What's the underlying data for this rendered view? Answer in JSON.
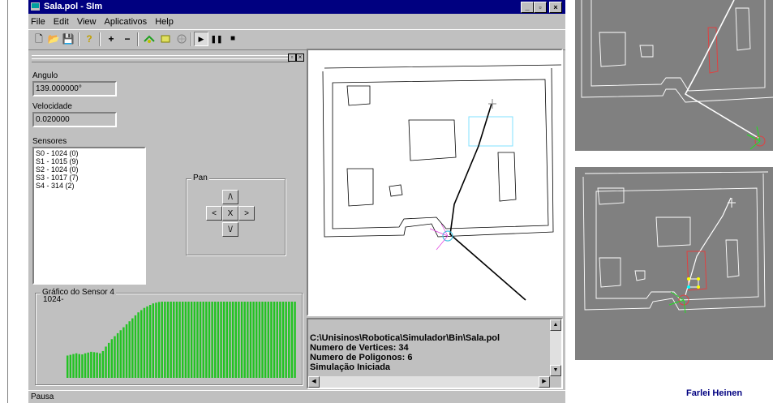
{
  "window": {
    "title": "Sala.pol - SIm",
    "minimize": "_",
    "maximize": "▫",
    "close": "×"
  },
  "menu": [
    "File",
    "Edit",
    "View",
    "Aplicativos",
    "Help"
  ],
  "toolbar": {
    "new": "🗋",
    "open": "📂",
    "save": "💾",
    "help": "?",
    "add": "+",
    "remove": "−",
    "play": "▶",
    "pause": "❚❚",
    "stop": "■"
  },
  "panel": {
    "angulo_label": "Angulo",
    "angulo_value": "139.000000°",
    "velocidade_label": "Velocidade",
    "velocidade_value": "0.020000",
    "sensores_label": "Sensores",
    "sensores": [
      "S0 - 1024 (0)",
      "S1 - 1015 (9)",
      "S2 - 1024 (0)",
      "S3 - 1017 (7)",
      "S4 - 314 (2)"
    ],
    "pan_label": "Pan",
    "pan": {
      "up": "/\\",
      "left": "<",
      "center": "X",
      "right": ">",
      "down": "\\/"
    },
    "grafico_label": "Gráfico do Sensor 4",
    "grafico_max": "1024-"
  },
  "log": {
    "lines": [
      "C:\\Unisinos\\Robotica\\Simulador\\Bin\\Sala.pol",
      "Numero de Vertices: 34",
      "Numero de Poligonos: 6",
      "Simulação Iniciada"
    ]
  },
  "status": "Pausa",
  "author": "Farlei Heinen",
  "colors": {
    "title_bar": "#000080",
    "chart_bar": "#22c322",
    "chart_bg": "#c0c0c0",
    "trail": "#000000",
    "sensor_highlight": "#80e0ff"
  },
  "chart_data": {
    "type": "bar",
    "title": "Gráfico do Sensor 4",
    "ylabel": "",
    "ylim": [
      0,
      1024
    ],
    "values": [
      300,
      310,
      320,
      330,
      320,
      315,
      330,
      340,
      350,
      345,
      340,
      330,
      360,
      420,
      470,
      520,
      560,
      600,
      640,
      680,
      720,
      760,
      800,
      840,
      880,
      910,
      940,
      960,
      980,
      1000,
      1010,
      1020,
      1024,
      1024,
      1024,
      1024,
      1024,
      1024,
      1024,
      1024,
      1024,
      1024,
      1024,
      1024,
      1024,
      1024,
      1024,
      1024,
      1024,
      1024,
      1024,
      1024,
      1024,
      1024,
      1024,
      1024,
      1024,
      1024,
      1024,
      1024,
      1024,
      1024,
      1024,
      1024,
      1024,
      1024,
      1024,
      1024,
      1024,
      1024,
      1024,
      1024,
      1024,
      1024,
      1024,
      1024,
      1024,
      1024
    ]
  }
}
